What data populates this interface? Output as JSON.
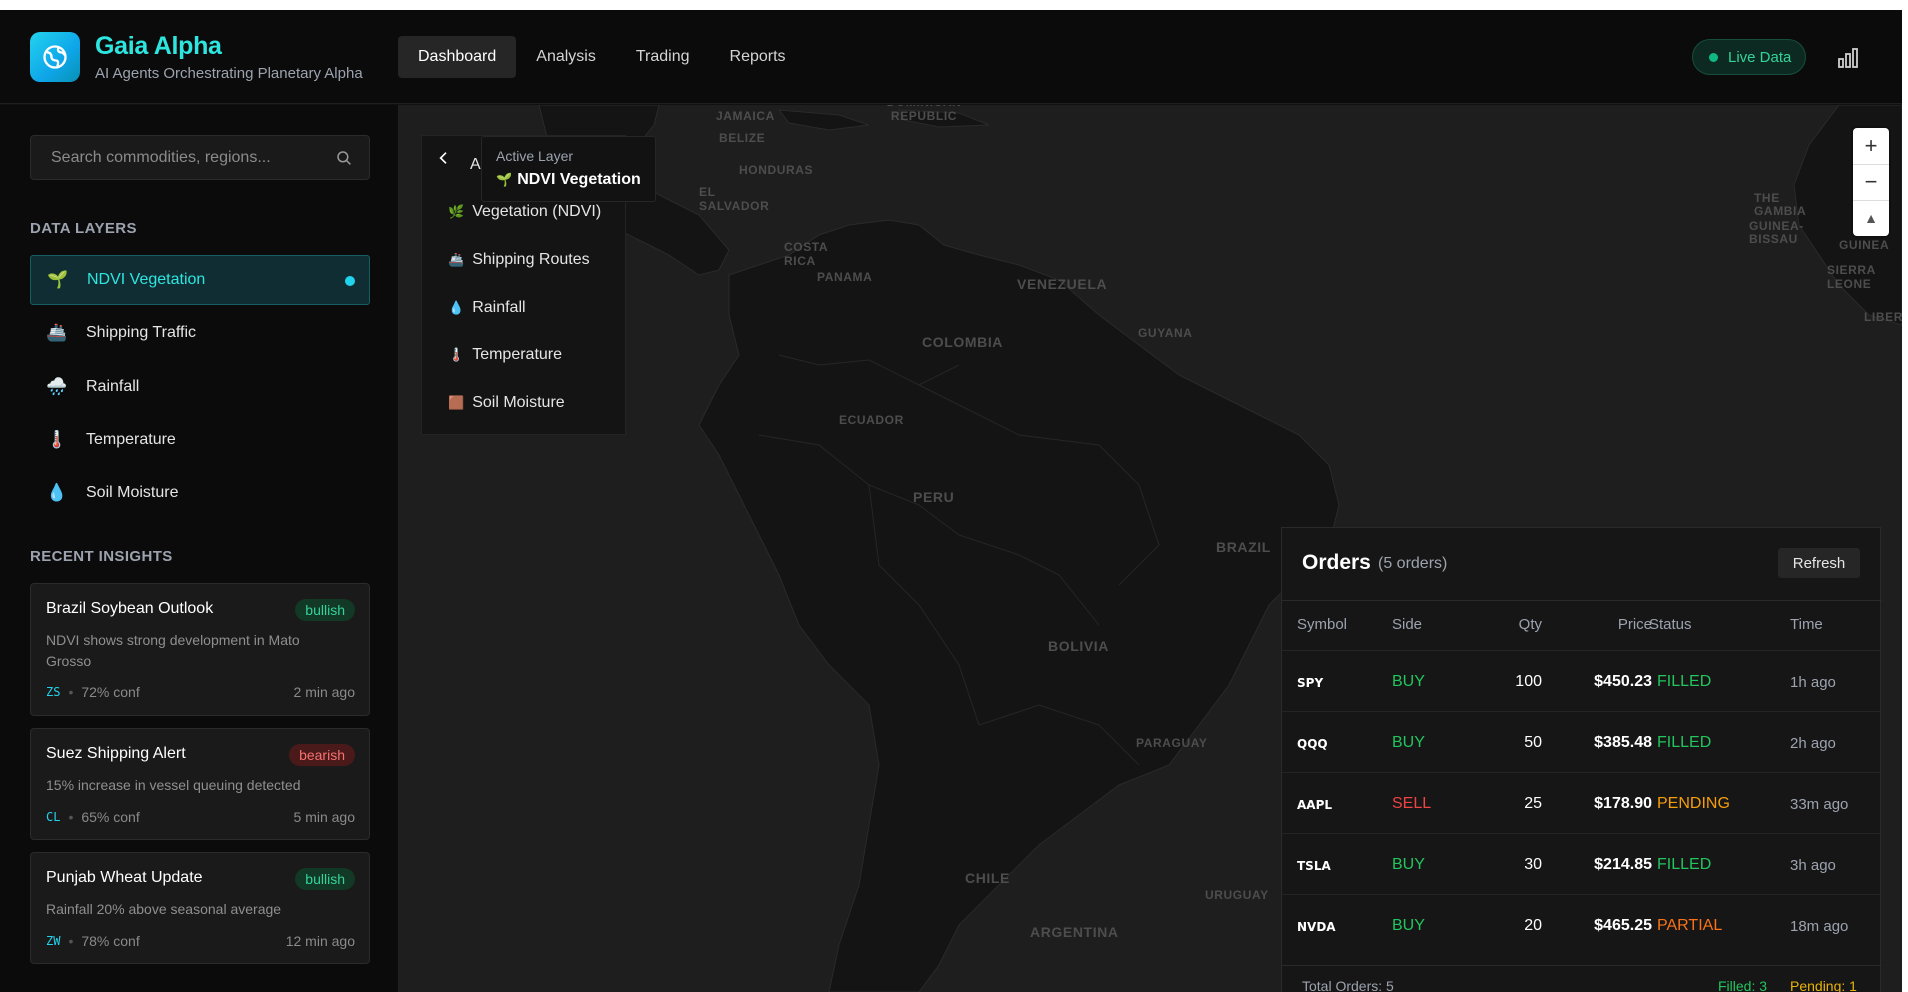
{
  "header": {
    "title": "Gaia Alpha",
    "subtitle": "AI Agents Orchestrating Planetary Alpha",
    "nav": [
      "Dashboard",
      "Analysis",
      "Trading",
      "Reports"
    ],
    "active_tab": "Dashboard",
    "live_label": "Live Data"
  },
  "sidebar": {
    "search_placeholder": "Search commodities, regions...",
    "layers_title": "DATA LAYERS",
    "layers": [
      {
        "icon": "🌱",
        "label": "NDVI Vegetation",
        "active": true
      },
      {
        "icon": "🚢",
        "label": "Shipping Traffic"
      },
      {
        "icon": "🌧️",
        "label": "Rainfall"
      },
      {
        "icon": "🌡️",
        "label": "Temperature"
      },
      {
        "icon": "💧",
        "label": "Soil Moisture"
      }
    ],
    "insights_title": "RECENT INSIGHTS",
    "insights": [
      {
        "title": "Brazil Soybean Outlook",
        "sentiment": "bullish",
        "desc": "NDVI shows strong development in Mato Grosso",
        "symbol": "ZS",
        "conf": "72% conf",
        "time": "2 min ago"
      },
      {
        "title": "Suez Shipping Alert",
        "sentiment": "bearish",
        "desc": "15% increase in vessel queuing detected",
        "symbol": "CL",
        "conf": "65% conf",
        "time": "5 min ago"
      },
      {
        "title": "Punjab Wheat Update",
        "sentiment": "bullish",
        "desc": "Rainfall 20% above seasonal average",
        "symbol": "ZW",
        "conf": "78% conf",
        "time": "12 min ago"
      }
    ]
  },
  "map": {
    "labels": [
      "Jamaica",
      "Dominican Republic",
      "Belize",
      "Honduras",
      "El Salvador",
      "Costa Rica",
      "Panama",
      "Venezuela",
      "Guyana",
      "Colombia",
      "Ecuador",
      "Peru",
      "Brazil",
      "Bolivia",
      "Paraguay",
      "Chile",
      "Uruguay",
      "Argentina",
      "The Gambia",
      "Guinea-Bissau",
      "Guinea",
      "Sierra Leone",
      "Liberia"
    ],
    "layer_panel": {
      "header_letter": "A",
      "items": [
        {
          "icon": "🌿",
          "label": "Vegetation (NDVI)"
        },
        {
          "icon": "🚢",
          "label": "Shipping Routes"
        },
        {
          "icon": "💧",
          "label": "Rainfall"
        },
        {
          "icon": "🌡️",
          "label": "Temperature"
        },
        {
          "icon": "🟫",
          "label": "Soil Moisture"
        }
      ]
    },
    "active_layer": {
      "label": "Active Layer",
      "icon": "🌱",
      "value": "NDVI Vegetation"
    },
    "zoom": {
      "in": "+",
      "out": "−",
      "reset": "▲"
    }
  },
  "orders": {
    "title": "Orders",
    "count": "(5 orders)",
    "refresh_label": "Refresh",
    "columns": [
      "Symbol",
      "Side",
      "Qty",
      "Price",
      "Status",
      "Time"
    ],
    "rows": [
      {
        "symbol": "SPY",
        "side": "BUY",
        "qty": "100",
        "price": "$450.23",
        "status": "FILLED",
        "time": "1h ago"
      },
      {
        "symbol": "QQQ",
        "side": "BUY",
        "qty": "50",
        "price": "$385.48",
        "status": "FILLED",
        "time": "2h ago"
      },
      {
        "symbol": "AAPL",
        "side": "SELL",
        "qty": "25",
        "price": "$178.90",
        "status": "PENDING",
        "time": "33m ago"
      },
      {
        "symbol": "TSLA",
        "side": "BUY",
        "qty": "30",
        "price": "$214.85",
        "status": "FILLED",
        "time": "3h ago"
      },
      {
        "symbol": "NVDA",
        "side": "BUY",
        "qty": "20",
        "price": "$465.25",
        "status": "PARTIAL",
        "time": "18m ago"
      }
    ],
    "footer": {
      "total": "Total Orders: 5",
      "filled": "Filled: 3",
      "pending": "Pending: 1"
    }
  },
  "colors": {
    "accent": "#2ee6e0",
    "buy": "#22c55e",
    "sell": "#ef4444",
    "pending": "#f59e0b",
    "partial": "#f97316"
  }
}
